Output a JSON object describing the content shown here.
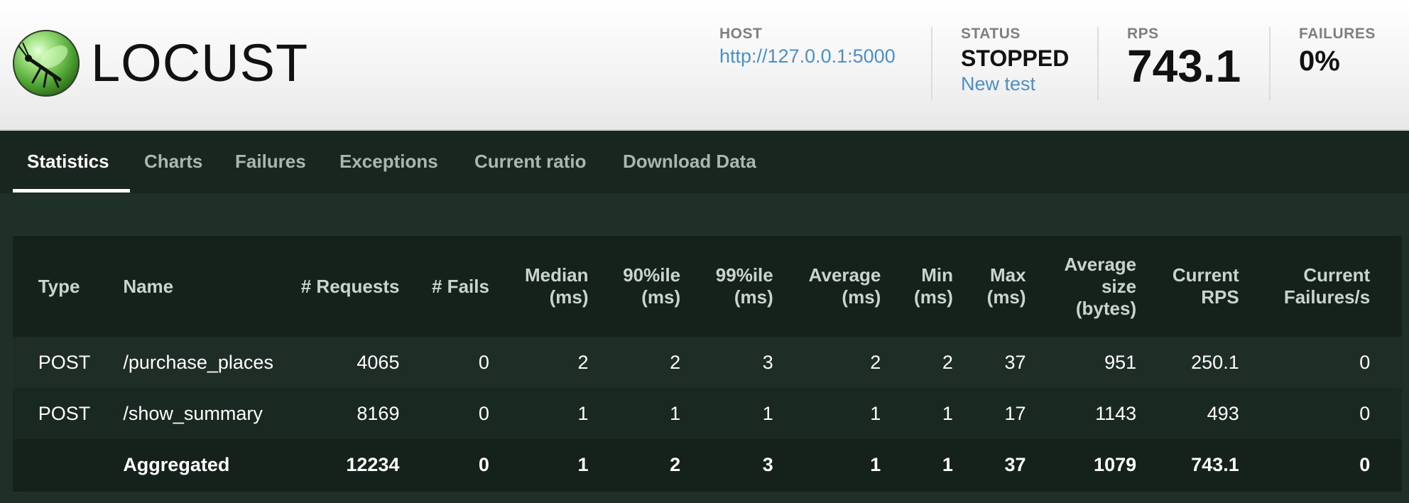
{
  "app": {
    "logo_text": "LOCUST"
  },
  "header": {
    "host": {
      "label": "HOST",
      "value": "http://127.0.0.1:5000"
    },
    "status": {
      "label": "STATUS",
      "value": "STOPPED",
      "link": "New test"
    },
    "rps": {
      "label": "RPS",
      "value": "743.1"
    },
    "failures": {
      "label": "FAILURES",
      "value": "0%"
    }
  },
  "tabs": [
    {
      "label": "Statistics",
      "active": true
    },
    {
      "label": "Charts",
      "active": false
    },
    {
      "label": "Failures",
      "active": false
    },
    {
      "label": "Exceptions",
      "active": false
    },
    {
      "label": "Current ratio",
      "active": false
    },
    {
      "label": "Download Data",
      "active": false
    }
  ],
  "table": {
    "columns": [
      {
        "line1": "Type"
      },
      {
        "line1": "Name"
      },
      {
        "line1": "# Requests"
      },
      {
        "line1": "# Fails"
      },
      {
        "line1": "Median",
        "line2": "(ms)"
      },
      {
        "line1": "90%ile",
        "line2": "(ms)"
      },
      {
        "line1": "99%ile",
        "line2": "(ms)"
      },
      {
        "line1": "Average",
        "line2": "(ms)"
      },
      {
        "line1": "Min",
        "line2": "(ms)"
      },
      {
        "line1": "Max",
        "line2": "(ms)"
      },
      {
        "line1": "Average",
        "line2": "size",
        "line3": "(bytes)"
      },
      {
        "line1": "Current",
        "line2": "RPS"
      },
      {
        "line1": "Current",
        "line2": "Failures/s"
      }
    ],
    "rows": [
      [
        "POST",
        "/purchase_places",
        "4065",
        "0",
        "2",
        "2",
        "3",
        "2",
        "2",
        "37",
        "951",
        "250.1",
        "0"
      ],
      [
        "POST",
        "/show_summary",
        "8169",
        "0",
        "1",
        "1",
        "1",
        "1",
        "1",
        "17",
        "1143",
        "493",
        "0"
      ]
    ],
    "aggregated": [
      "",
      "Aggregated",
      "12234",
      "0",
      "1",
      "2",
      "3",
      "1",
      "1",
      "37",
      "1079",
      "743.1",
      "0"
    ]
  }
}
